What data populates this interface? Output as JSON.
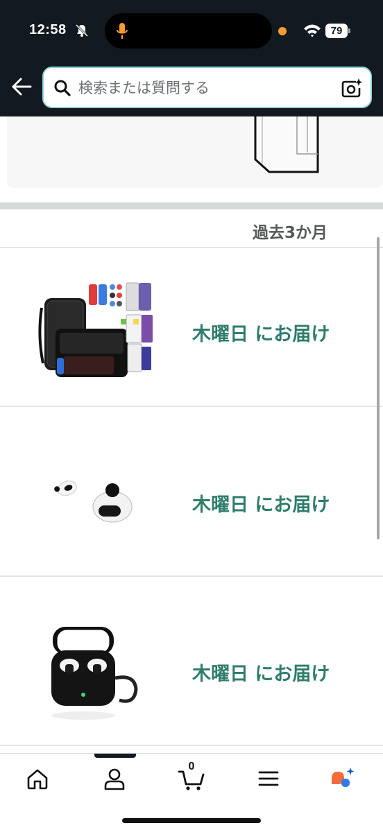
{
  "status_bar": {
    "time": "12:58",
    "battery": "79"
  },
  "search": {
    "placeholder": "検索または質問する"
  },
  "orders": {
    "section_title": "過去3か月",
    "items": [
      {
        "delivery": "木曜日 にお届け",
        "image": "switch-case-accessory-set"
      },
      {
        "delivery": "木曜日 にお届け",
        "image": "wireless-earbuds"
      },
      {
        "delivery": "木曜日 にお届け",
        "image": "earbuds-case-with-carabiner"
      }
    ]
  },
  "bottom_nav": {
    "cart_count": "0",
    "items": [
      "home-icon",
      "account-icon",
      "cart-icon",
      "menu-icon",
      "ai-assistant-icon"
    ]
  },
  "colors": {
    "header_bg": "#131921",
    "search_border": "#8ed1d6",
    "delivery_text": "#2e7d6b",
    "mic_active": "#f79b2e"
  }
}
